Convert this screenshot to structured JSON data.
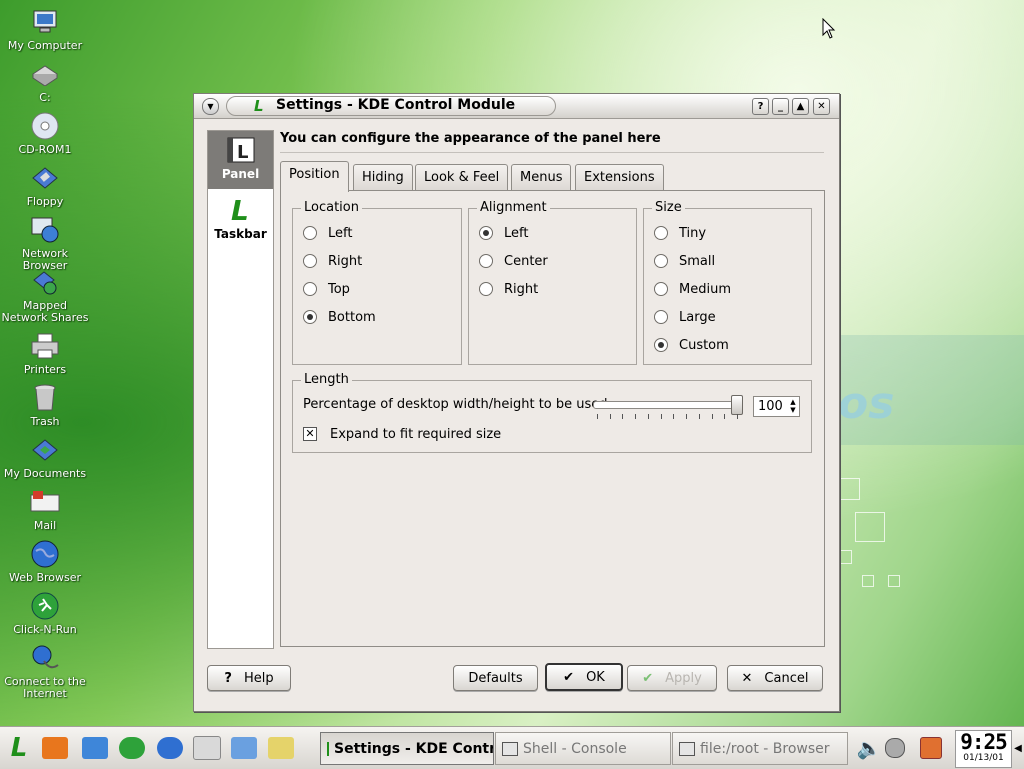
{
  "desktop": {
    "icons": [
      {
        "label": "My Computer",
        "icon": "computer-icon"
      },
      {
        "label": "C:",
        "icon": "drive-icon"
      },
      {
        "label": "CD-ROM1",
        "icon": "cdrom-icon"
      },
      {
        "label": "Floppy",
        "icon": "floppy-icon"
      },
      {
        "label": "Network Browser",
        "icon": "network-icon"
      },
      {
        "label": "Mapped Network Shares",
        "icon": "network-shares-icon"
      },
      {
        "label": "Printers",
        "icon": "printer-icon"
      },
      {
        "label": "Trash",
        "icon": "trash-icon"
      },
      {
        "label": "My Documents",
        "icon": "documents-icon"
      },
      {
        "label": "Mail",
        "icon": "mail-icon"
      },
      {
        "label": "Web Browser",
        "icon": "globe-icon"
      },
      {
        "label": "Click-N-Run",
        "icon": "runner-icon"
      },
      {
        "label": "Connect to the Internet",
        "icon": "connect-icon"
      }
    ]
  },
  "window": {
    "title": "Settings - KDE Control Module",
    "buttons": {
      "help": "?",
      "minimize": "_",
      "maximize": "▲",
      "close": "✕"
    }
  },
  "nav": {
    "items": [
      {
        "label": "Panel",
        "selected": true
      },
      {
        "label": "Taskbar",
        "selected": false
      }
    ]
  },
  "heading": "You can configure the appearance of the panel here",
  "tabs": [
    {
      "label": "Position",
      "active": true
    },
    {
      "label": "Hiding",
      "active": false
    },
    {
      "label": "Look & Feel",
      "active": false
    },
    {
      "label": "Menus",
      "active": false
    },
    {
      "label": "Extensions",
      "active": false
    }
  ],
  "location": {
    "title": "Location",
    "options": [
      "Left",
      "Right",
      "Top",
      "Bottom"
    ],
    "selected": "Bottom"
  },
  "alignment": {
    "title": "Alignment",
    "options": [
      "Left",
      "Center",
      "Right"
    ],
    "selected": "Left"
  },
  "size": {
    "title": "Size",
    "options": [
      "Tiny",
      "Small",
      "Medium",
      "Large",
      "Custom"
    ],
    "selected": "Custom"
  },
  "length": {
    "title": "Length",
    "percentage_label": "Percentage of desktop width/height to be used:",
    "value": "100",
    "slider_fraction": 1.0,
    "expand_label": "Expand to fit required size",
    "expand_checked": true
  },
  "footer": {
    "help": "Help",
    "defaults": "Defaults",
    "ok": "OK",
    "apply": "Apply",
    "cancel": "Cancel"
  },
  "taskbar": {
    "tasks": [
      {
        "label": "Settings - KDE Contr",
        "active": true
      },
      {
        "label": "Shell - Console",
        "active": false
      },
      {
        "label": "file:/root - Browser",
        "active": false
      }
    ],
    "clock": {
      "time": "9:25",
      "date": "01/13/01"
    }
  },
  "colors": {
    "accent_green": "#1f8f1a",
    "window_bg": "#eeeae6",
    "nav_selected": "#7d7b78"
  }
}
